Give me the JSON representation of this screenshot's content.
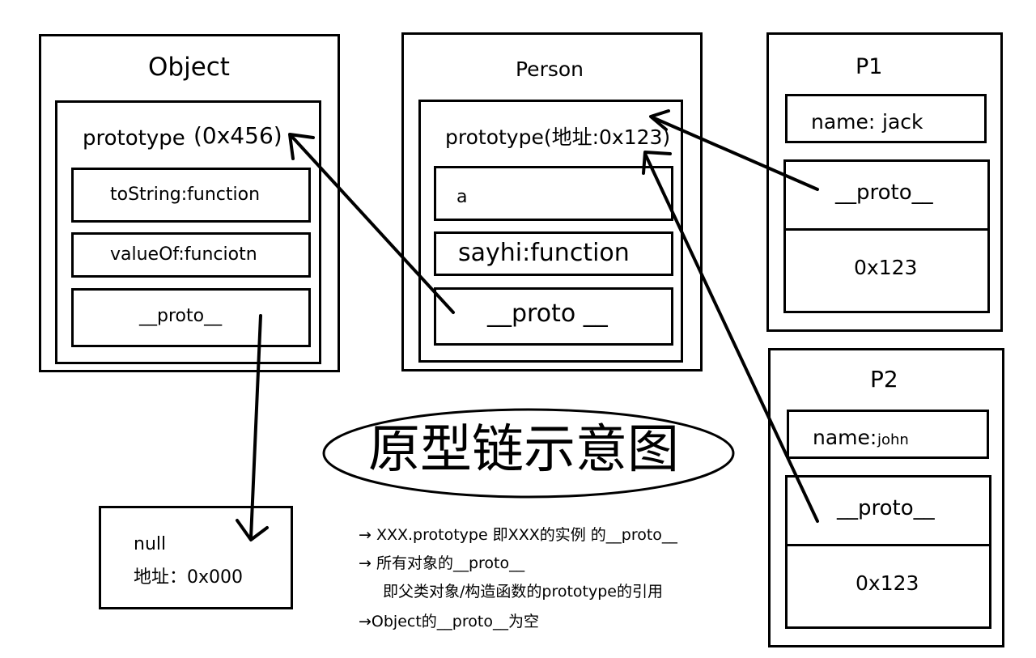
{
  "object": {
    "title": "Object",
    "prototype_label": "prototype",
    "prototype_addr": "(0x456)",
    "fields": [
      "toString:function",
      "valueOf:funciotn",
      "__proto__"
    ]
  },
  "person": {
    "title": "Person",
    "prototype_label": "prototype(地址:0x123)",
    "fields": [
      "a",
      "sayhi:function",
      "__proto __"
    ]
  },
  "p1": {
    "title": "P1",
    "name_label": "name:",
    "name_value": "jack",
    "proto_label": "__proto__",
    "addr": "0x123"
  },
  "p2": {
    "title": "P2",
    "name_label": "name:",
    "name_value": "john",
    "proto_label": "__proto__",
    "addr": "0x123"
  },
  "null_box": {
    "label": "null",
    "addr": "地址：0x000"
  },
  "diagram_title": "原型链示意图",
  "notes": [
    "→ XXX.prototype 即XXX的实例 的__proto__",
    "→ 所有对象的__proto__",
    "即父类对象/构造函数的prototype的引用",
    "→Object的__proto__为空"
  ]
}
